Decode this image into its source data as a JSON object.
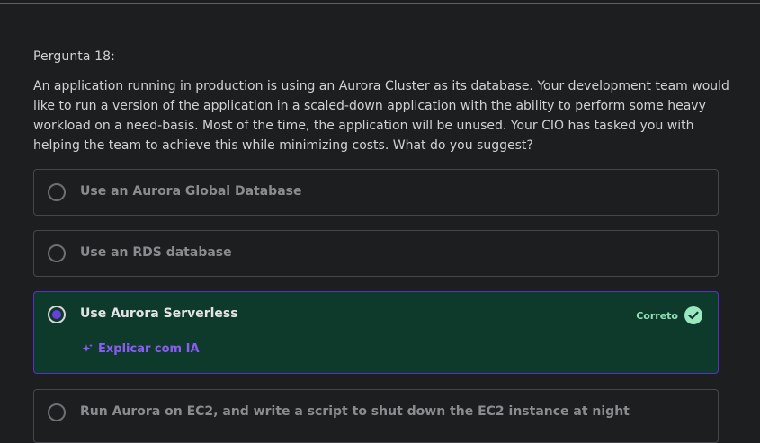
{
  "question": {
    "label": "Pergunta 18:",
    "text": "An application running in production is using an Aurora Cluster as its database. Your development team would like to run a version of the application in a scaled-down application with the ability to perform some heavy workload on a need-basis. Most of the time, the application will be unused. Your CIO has tasked you with helping the team to achieve this while minimizing costs. What do you suggest?"
  },
  "options": [
    {
      "label": "Use an Aurora Global Database"
    },
    {
      "label": "Use an RDS database"
    },
    {
      "label": "Use Aurora Serverless",
      "selected": true,
      "status": "Correto",
      "explain_label": "Explicar com IA"
    },
    {
      "label": "Run Aurora on EC2, and write a script to shut down the EC2 instance at night"
    }
  ],
  "colors": {
    "selected_bg": "#0e3a2b",
    "selected_border": "#5b2fc4",
    "accent_purple": "#8a5cf5",
    "correct_green": "#9ae8c0"
  },
  "icons": {
    "correct": "check-circle-icon",
    "explain": "sparkle-icon"
  }
}
